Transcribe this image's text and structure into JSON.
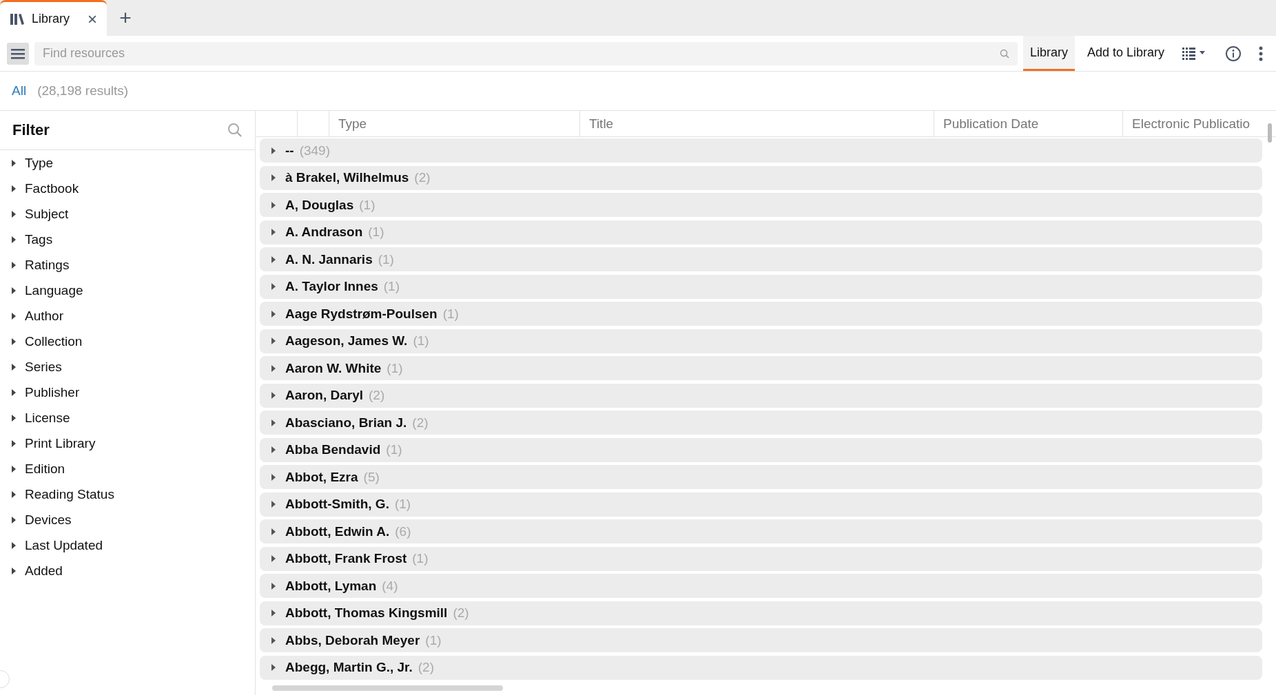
{
  "tabs": [
    {
      "label": "Library",
      "selected": true,
      "close": "×"
    }
  ],
  "new_tab": "+",
  "toolbar": {
    "search": {
      "placeholder": "Find resources"
    },
    "view_tabs": [
      {
        "label": "Library",
        "selected": true
      },
      {
        "label": "Add to Library",
        "selected": false
      }
    ]
  },
  "scope": {
    "label": "All",
    "count": "(28,198 results)"
  },
  "filter": {
    "title": "Filter",
    "items": [
      {
        "label": "Type",
        "expanded": false
      },
      {
        "label": "Factbook",
        "expanded": false
      },
      {
        "label": "Subject",
        "expanded": false
      },
      {
        "label": "Tags",
        "expanded": false
      },
      {
        "label": "Ratings",
        "expanded": false
      },
      {
        "label": "Language",
        "expanded": false
      },
      {
        "label": "Author",
        "expanded": false
      },
      {
        "label": "Collection",
        "expanded": false
      },
      {
        "label": "Series",
        "expanded": false
      },
      {
        "label": "Publisher",
        "expanded": false
      },
      {
        "label": "License",
        "expanded": false
      },
      {
        "label": "Print Library",
        "expanded": false
      },
      {
        "label": "Edition",
        "expanded": false
      },
      {
        "label": "Reading Status",
        "expanded": false
      },
      {
        "label": "Devices",
        "expanded": false
      },
      {
        "label": "Last Updated",
        "expanded": false
      },
      {
        "label": "Added",
        "expanded": false
      }
    ]
  },
  "table": {
    "columns": [
      "Type",
      "Title",
      "Publication Date",
      "Electronic Publicatio"
    ],
    "groups": [
      {
        "name": "--",
        "count": "(349)",
        "expanded": false
      },
      {
        "name": "à Brakel, Wilhelmus",
        "count": "(2)",
        "expanded": false
      },
      {
        "name": "A, Douglas",
        "count": "(1)",
        "expanded": false
      },
      {
        "name": "A. Andrason",
        "count": "(1)",
        "expanded": false
      },
      {
        "name": "A. N. Jannaris",
        "count": "(1)",
        "expanded": false
      },
      {
        "name": "A. Taylor Innes",
        "count": "(1)",
        "expanded": false
      },
      {
        "name": "Aage Rydstrøm-Poulsen",
        "count": "(1)",
        "expanded": false
      },
      {
        "name": "Aageson, James W.",
        "count": "(1)",
        "expanded": false
      },
      {
        "name": "Aaron W. White",
        "count": "(1)",
        "expanded": false
      },
      {
        "name": "Aaron, Daryl",
        "count": "(2)",
        "expanded": false
      },
      {
        "name": "Abasciano, Brian J.",
        "count": "(2)",
        "expanded": false
      },
      {
        "name": "Abba Bendavid",
        "count": "(1)",
        "expanded": false
      },
      {
        "name": "Abbot, Ezra",
        "count": "(5)",
        "expanded": false
      },
      {
        "name": "Abbott-Smith, G.",
        "count": "(1)",
        "expanded": false
      },
      {
        "name": "Abbott, Edwin A.",
        "count": "(6)",
        "expanded": false
      },
      {
        "name": "Abbott, Frank Frost",
        "count": "(1)",
        "expanded": false
      },
      {
        "name": "Abbott, Lyman",
        "count": "(4)",
        "expanded": false
      },
      {
        "name": "Abbott, Thomas Kingsmill",
        "count": "(2)",
        "expanded": false
      },
      {
        "name": "Abbs, Deborah Meyer",
        "count": "(1)",
        "expanded": false
      },
      {
        "name": "Abegg, Martin G., Jr.",
        "count": "(2)",
        "expanded": false
      }
    ]
  }
}
